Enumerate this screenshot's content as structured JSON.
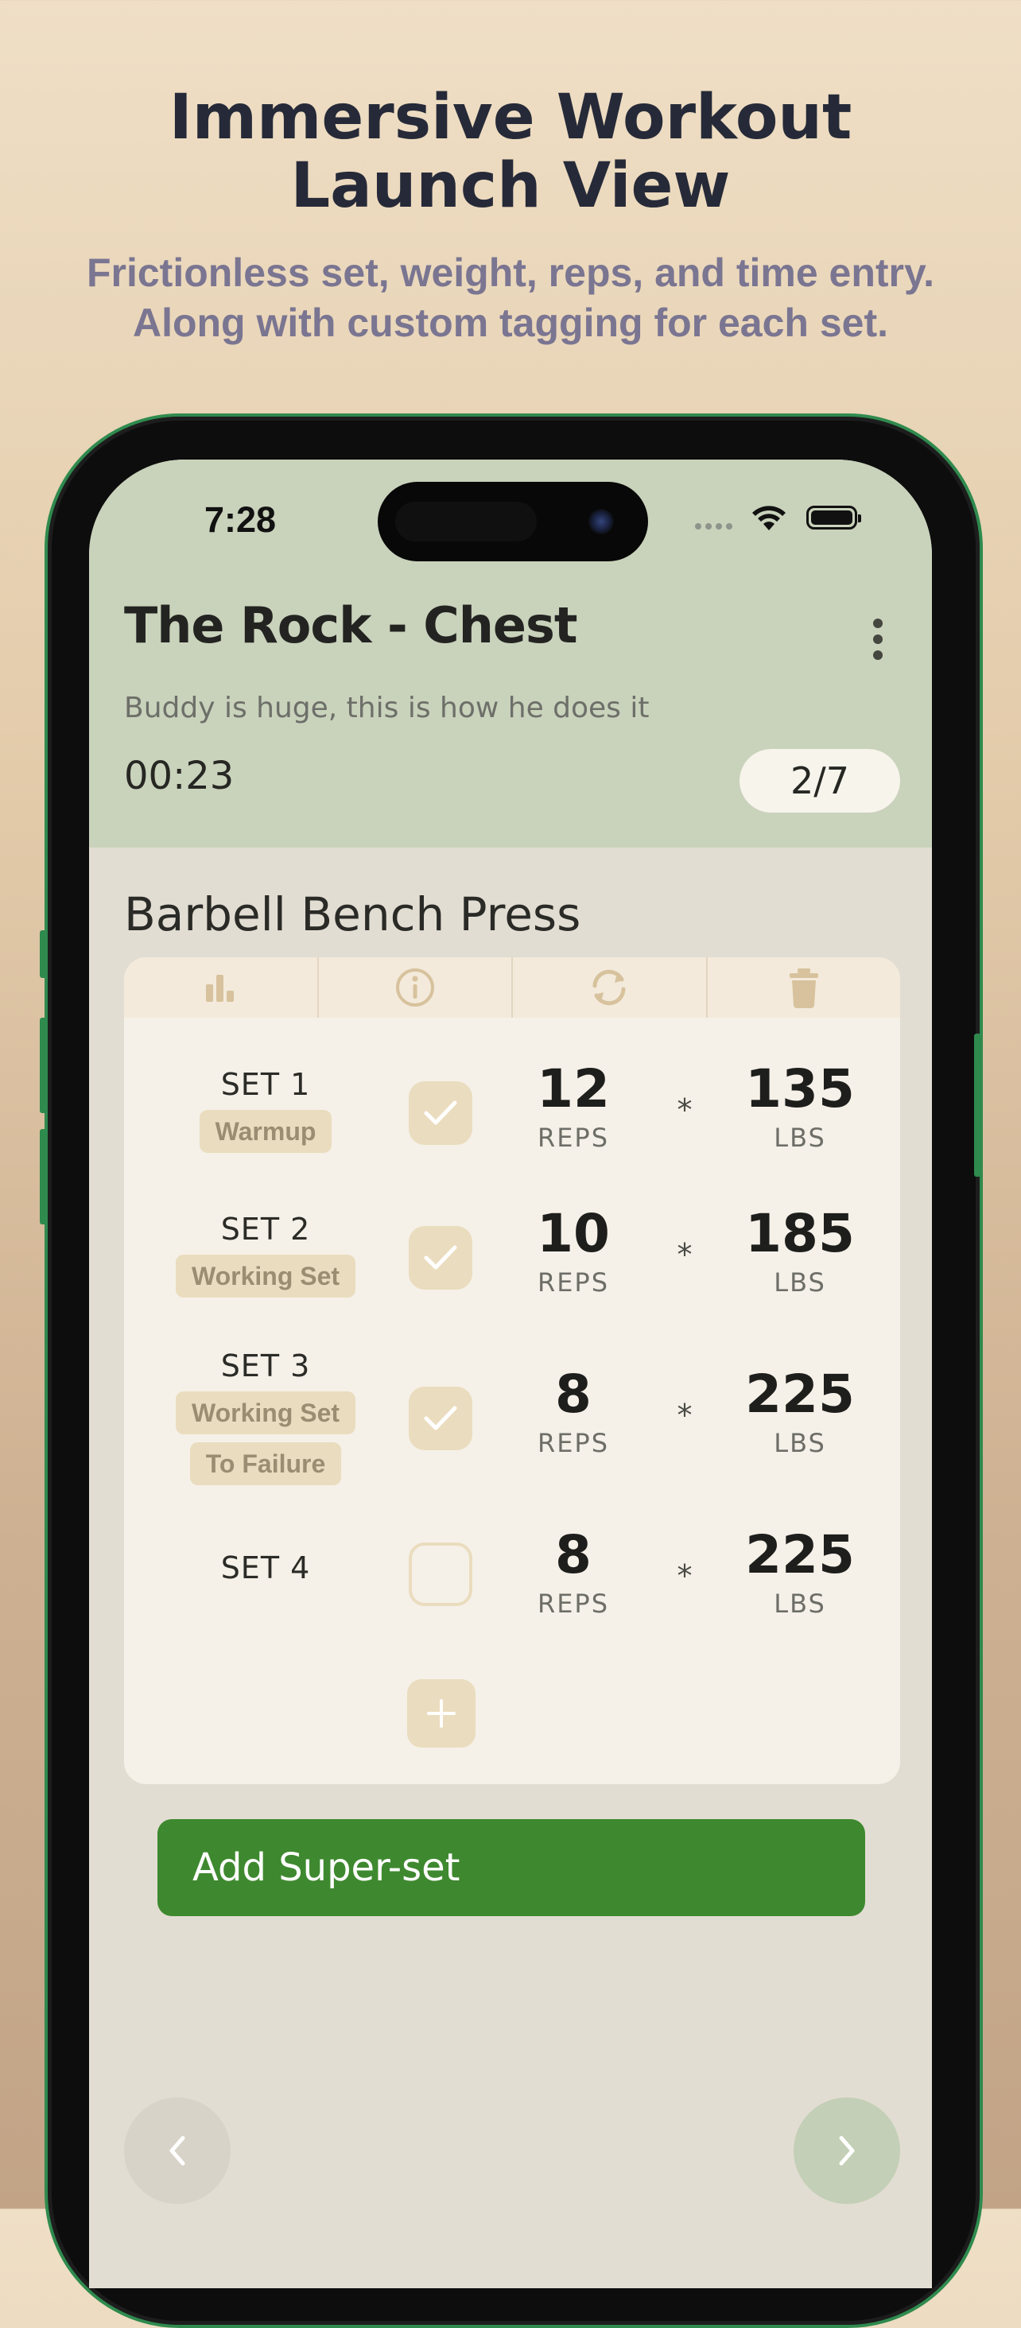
{
  "promo": {
    "headline_line1": "Immersive Workout",
    "headline_line2": "Launch View",
    "subline_line1": "Frictionless set, weight, reps, and time entry.",
    "subline_line2": "Along with custom tagging for each set."
  },
  "status_bar": {
    "time": "7:28"
  },
  "workout": {
    "title": "The Rock - Chest",
    "description": "Buddy is huge, this is how he does it",
    "timer": "00:23",
    "progress": "2/7"
  },
  "exercise": {
    "name": "Barbell Bench Press",
    "tabs": [
      {
        "icon": "bar-chart-icon"
      },
      {
        "icon": "info-icon"
      },
      {
        "icon": "swap-icon"
      },
      {
        "icon": "trash-icon"
      }
    ],
    "separator": "*",
    "sets": [
      {
        "label": "SET 1",
        "tags": [
          "Warmup"
        ],
        "completed": true,
        "reps": "12",
        "reps_unit": "REPS",
        "weight": "135",
        "weight_unit": "LBS"
      },
      {
        "label": "SET 2",
        "tags": [
          "Working Set"
        ],
        "completed": true,
        "reps": "10",
        "reps_unit": "REPS",
        "weight": "185",
        "weight_unit": "LBS"
      },
      {
        "label": "SET 3",
        "tags": [
          "Working Set",
          "To Failure"
        ],
        "completed": true,
        "reps": "8",
        "reps_unit": "REPS",
        "weight": "225",
        "weight_unit": "LBS"
      },
      {
        "label": "SET 4",
        "tags": [],
        "completed": false,
        "reps": "8",
        "reps_unit": "REPS",
        "weight": "225",
        "weight_unit": "LBS"
      }
    ]
  },
  "actions": {
    "add_superset": "Add Super-set"
  },
  "colors": {
    "accent_green": "#3e892f",
    "header_bg": "#c9d2bb",
    "tag_bg": "#eadcbe",
    "phone_frame": "#2f8a4e"
  }
}
